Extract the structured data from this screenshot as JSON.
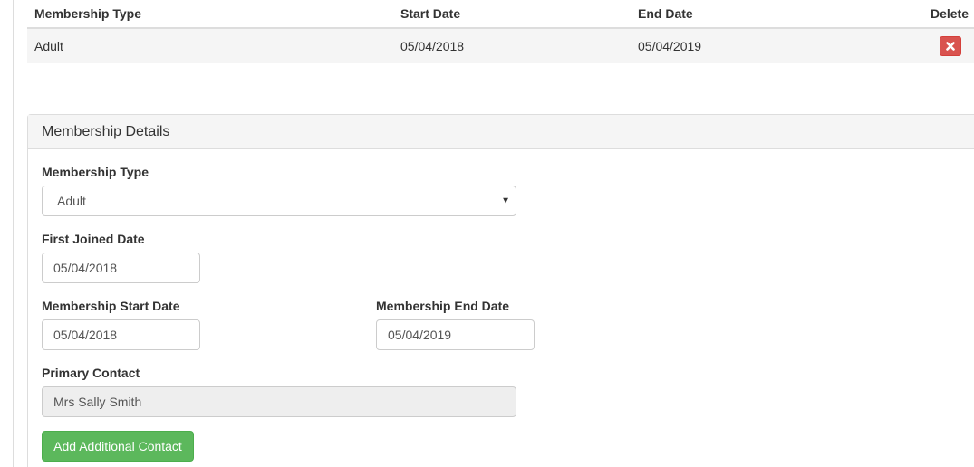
{
  "table": {
    "headers": {
      "type": "Membership Type",
      "start": "Start Date",
      "end": "End Date",
      "delete": "Delete"
    },
    "rows": [
      {
        "type": "Adult",
        "start": "05/04/2018",
        "end": "05/04/2019",
        "delete_icon": "close-icon"
      }
    ]
  },
  "panel": {
    "title": "Membership Details",
    "membership_type": {
      "label": "Membership Type",
      "value": "Adult",
      "icon": "caret-down-icon"
    },
    "first_joined": {
      "label": "First Joined Date",
      "value": "05/04/2018"
    },
    "start_date": {
      "label": "Membership Start Date",
      "value": "05/04/2018"
    },
    "end_date": {
      "label": "Membership End Date",
      "value": "05/04/2019"
    },
    "primary_contact": {
      "label": "Primary Contact",
      "value": "Mrs Sally Smith"
    },
    "add_contact_label": "Add Additional Contact"
  },
  "colors": {
    "danger": "#d9534f",
    "success": "#5cb85c",
    "row_bg": "#f5f5f5",
    "readonly_bg": "#eeeeee"
  }
}
